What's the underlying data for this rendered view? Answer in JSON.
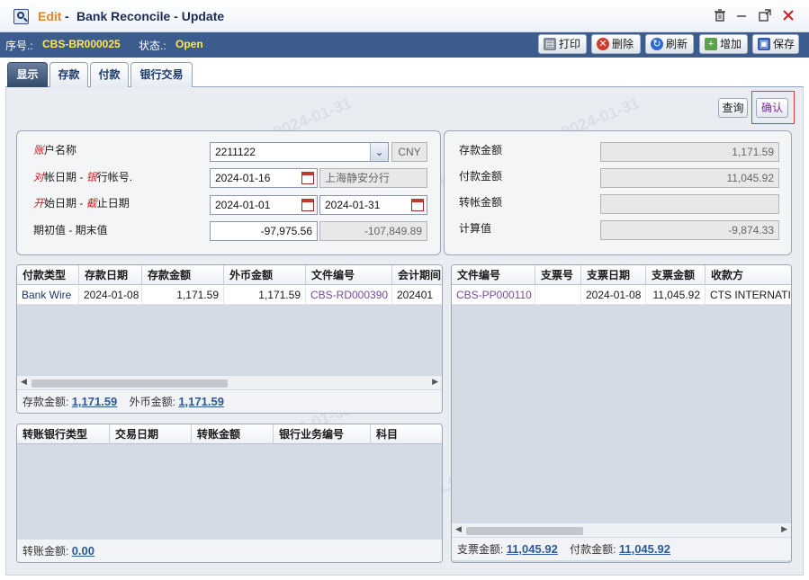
{
  "window": {
    "mode": "Edit",
    "separator": "-",
    "title": "Bank Reconcile - Update",
    "icons": [
      "search-document-icon",
      "trash-icon",
      "minimize-icon",
      "restore-icon",
      "close-icon"
    ]
  },
  "info": {
    "seq_label": "序号.:",
    "seq_value": "CBS-BR000025",
    "status_label": "状态.:",
    "status_value": "Open"
  },
  "toolbar": {
    "print": "打印",
    "delete": "删除",
    "refresh": "刷新",
    "add": "增加",
    "save": "保存"
  },
  "tabs": [
    "显示",
    "存款",
    "付款",
    "银行交易"
  ],
  "actions": {
    "query": "查询",
    "confirm": "确认"
  },
  "form": {
    "account_name": {
      "label_red": "账",
      "label_rest": "户名称",
      "value": "2211122",
      "currency": "CNY"
    },
    "recon_date": {
      "label_red1": "对",
      "label_mid1": "帐日期 - ",
      "label_red2": "银",
      "label_rest2": "行帐号.",
      "date": "2024-01-16",
      "bank": "上海静安分行"
    },
    "start_date": {
      "label_red1": "开",
      "label_mid1": "始日期 - ",
      "label_red2": "截",
      "label_rest2": "止日期",
      "start": "2024-01-01",
      "end": "2024-01-31"
    },
    "opening": {
      "label": "期初值 - 期末值",
      "start_value": "-97,975.56",
      "end_value": "-107,849.89"
    }
  },
  "summary": {
    "deposit_label": "存款金额",
    "deposit_value": "1,171.59",
    "payment_label": "付款金额",
    "payment_value": "11,045.92",
    "transfer_label": "转帐金额",
    "transfer_value": "",
    "calc_label": "计算值",
    "calc_value": "-9,874.33"
  },
  "deposit_grid": {
    "columns": [
      "付款类型",
      "存款日期",
      "存款金额",
      "外币金额",
      "文件编号",
      "会计期间"
    ],
    "rows": [
      [
        "Bank Wire",
        "2024-01-08",
        "1,171.59",
        "1,171.59",
        "CBS-RD000390",
        "202401"
      ]
    ],
    "footer_label1": "存款金额:",
    "footer_value1": "1,171.59",
    "footer_label2": "外币金额:",
    "footer_value2": "1,171.59"
  },
  "transfer_grid": {
    "columns": [
      "转账银行类型",
      "交易日期",
      "转账金额",
      "银行业务编号",
      "科目"
    ],
    "footer_label": "转账金额:",
    "footer_value": "0.00"
  },
  "payment_grid": {
    "columns": [
      "文件编号",
      "支票号",
      "支票日期",
      "支票金额",
      "收款方"
    ],
    "rows": [
      [
        "CBS-PP000110",
        "",
        "2024-01-08",
        "11,045.92",
        "CTS INTERNATIONAL"
      ]
    ],
    "footer_label1": "支票金额:",
    "footer_value1": "11,045.92",
    "footer_label2": "付款金额:",
    "footer_value2": "11,045.92"
  },
  "watermark": "TLKA.CBS.Admin 2024-01-31"
}
